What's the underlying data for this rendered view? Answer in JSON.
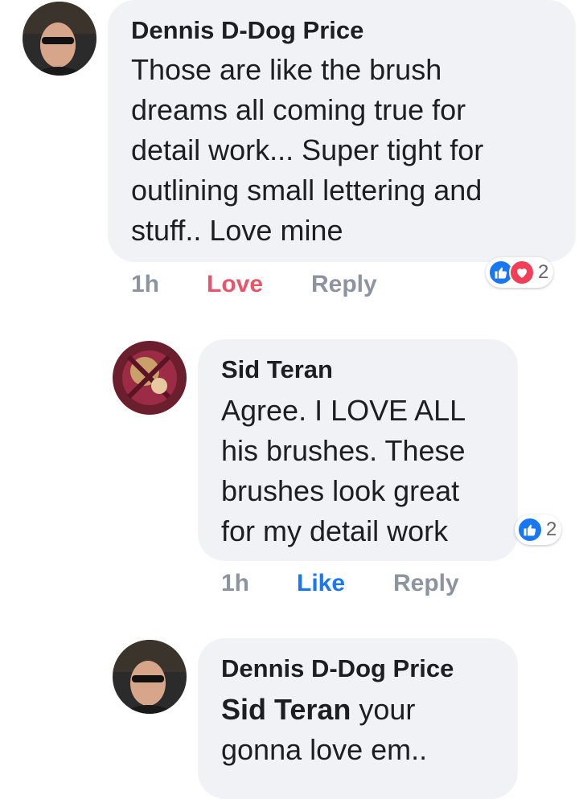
{
  "comments": [
    {
      "author": "Dennis D-Dog Price",
      "text_lines": [
        "Those are like the brush",
        "dreams all coming true for",
        "detail work... Super tight for",
        "outlining small lettering and",
        "stuff.. Love mine"
      ],
      "time": "1h",
      "reaction_action": "Love",
      "reply_label": "Reply",
      "reaction_count": "2",
      "reaction_types": [
        "like-icon",
        "heart-icon"
      ],
      "reaction_action_color": "#e9546b"
    },
    {
      "author": "Sid Teran",
      "text_lines": [
        "Agree. I LOVE ALL",
        "his brushes. These",
        "brushes look great",
        "for my detail work"
      ],
      "time": "1h",
      "reaction_action": "Like",
      "reply_label": "Reply",
      "reaction_count": "2",
      "reaction_types": [
        "like-icon"
      ],
      "reaction_action_color": "#1877f2"
    },
    {
      "author": "Dennis D-Dog Price",
      "mention": "Sid Teran",
      "text_after_mention": " your",
      "text_lines": [
        "gonna love em.."
      ]
    }
  ],
  "colors": {
    "bubble": "#f0f2f5",
    "meta_text": "#8d949e",
    "like_blue": "#1877f2",
    "love_red": "#e9546b"
  }
}
